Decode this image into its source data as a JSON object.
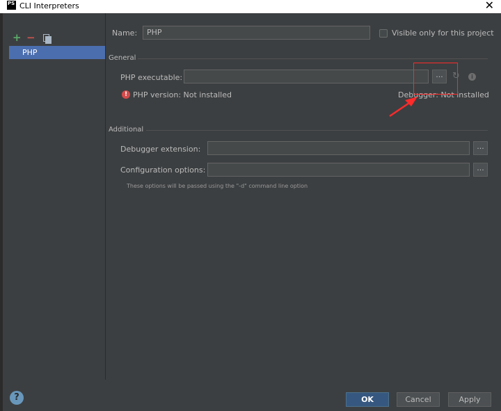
{
  "window": {
    "title": "CLI Interpreters",
    "app_icon_text": "PS",
    "close_glyph": "✕"
  },
  "sidebar": {
    "add_glyph": "+",
    "remove_glyph": "−",
    "items": [
      {
        "label": "PHP"
      }
    ]
  },
  "form": {
    "name_label": "Name:",
    "name_value": "PHP",
    "visible_only_label": "Visible only for this project",
    "visible_only_checked": false
  },
  "general": {
    "section_label": "General",
    "php_executable_label": "PHP executable:",
    "php_executable_value": "",
    "browse_label": "...",
    "refresh_glyph": "↻",
    "info_glyph": "i",
    "php_version_text": "PHP version: Not installed",
    "debugger_text": "Debugger: Not installed",
    "error_glyph": "!"
  },
  "additional": {
    "section_label": "Additional",
    "debugger_extension_label": "Debugger extension:",
    "debugger_extension_value": "",
    "debugger_extension_browse": "...",
    "config_options_label": "Configuration options:",
    "config_options_value": "",
    "config_options_browse": "...",
    "hint_text": "These options will be passed using the \"-d\" command line option"
  },
  "footer": {
    "help_glyph": "?",
    "ok_label": "OK",
    "cancel_label": "Cancel",
    "apply_label": "Apply"
  },
  "colors": {
    "background": "#3c3f41",
    "selection": "#4b6eaf",
    "annotation": "#ff2a2a",
    "error": "#d44b4b",
    "primary_button": "#365880"
  }
}
